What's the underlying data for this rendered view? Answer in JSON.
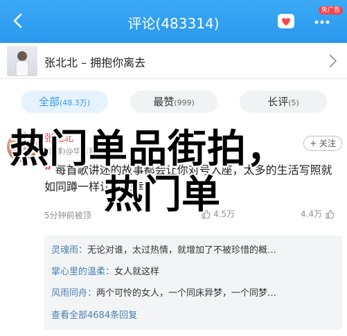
{
  "header": {
    "title": "评论(483314)",
    "badge": "免广告",
    "accent": "#2b98ee"
  },
  "song": {
    "title": "张北北 – 拥抱你离去"
  },
  "tabs": [
    {
      "label": "全部",
      "count": "(48.3万)"
    },
    {
      "label": "最赞",
      "count": "(999)"
    },
    {
      "label": "长评",
      "count": "(5)"
    }
  ],
  "comment": {
    "name": "张北北",
    "source": "(微博)@华语音乐榜",
    "follow": "+ 关注",
    "body_prefix": "“",
    "body": "每首歌讲述的故事都会让你对号入座，太多的生活写照就如同蹲一样让你庆幸",
    "meta": "5分钟前被顶",
    "likes_mid": "4.5万",
    "likes_right": "4.4万"
  },
  "replies": [
    {
      "who": "灵魂雨：",
      "text": "无论对谁，太过热情，就增加了不被珍惜的概…"
    },
    {
      "who": "掌心里的温柔：",
      "text": "女人就这样"
    },
    {
      "who": "风雨同舟：",
      "text": "两个可怜的女人，一个同床异梦，一个同梦…"
    }
  ],
  "replies_more": "查看全部4684条回复",
  "overlay": {
    "line1": "热门单品街拍，",
    "line2": "热门单"
  },
  "icons": {
    "back": "back-chevron-icon",
    "share": "share-heart-icon",
    "more": "more-dots-icon",
    "song_chevron": "chevron-right-icon",
    "like": "thumb-up-icon"
  }
}
